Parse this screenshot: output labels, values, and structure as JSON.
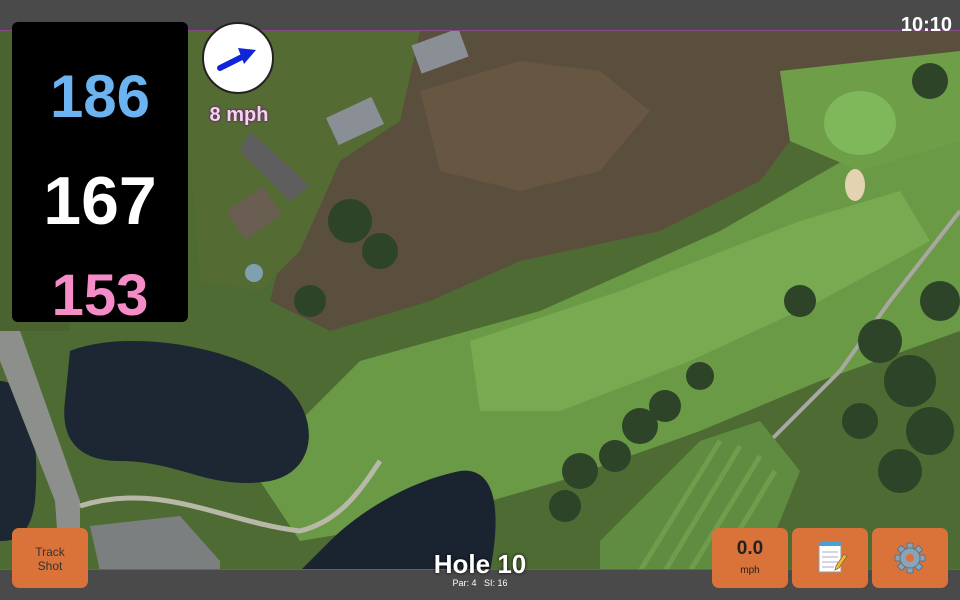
{
  "status": {
    "time": "10:10"
  },
  "yardages": {
    "back": "186",
    "middle": "167",
    "front": "153"
  },
  "wind": {
    "speed": "8 mph",
    "icon": "wind-arrow-icon"
  },
  "controls": {
    "track_shot_line1": "Track",
    "track_shot_line2": "Shot",
    "speed_value": "0.0",
    "speed_unit": "mph",
    "notes_icon": "notepad-icon",
    "settings_icon": "gear-icon"
  },
  "hole": {
    "title": "Hole 10",
    "par": "Par: 4",
    "si": "SI: 16"
  },
  "colors": {
    "back": "#6cb3f2",
    "middle": "#ffffff",
    "front": "#f58cc8",
    "button": "#d9733a",
    "bar": "#4a4a4a"
  }
}
